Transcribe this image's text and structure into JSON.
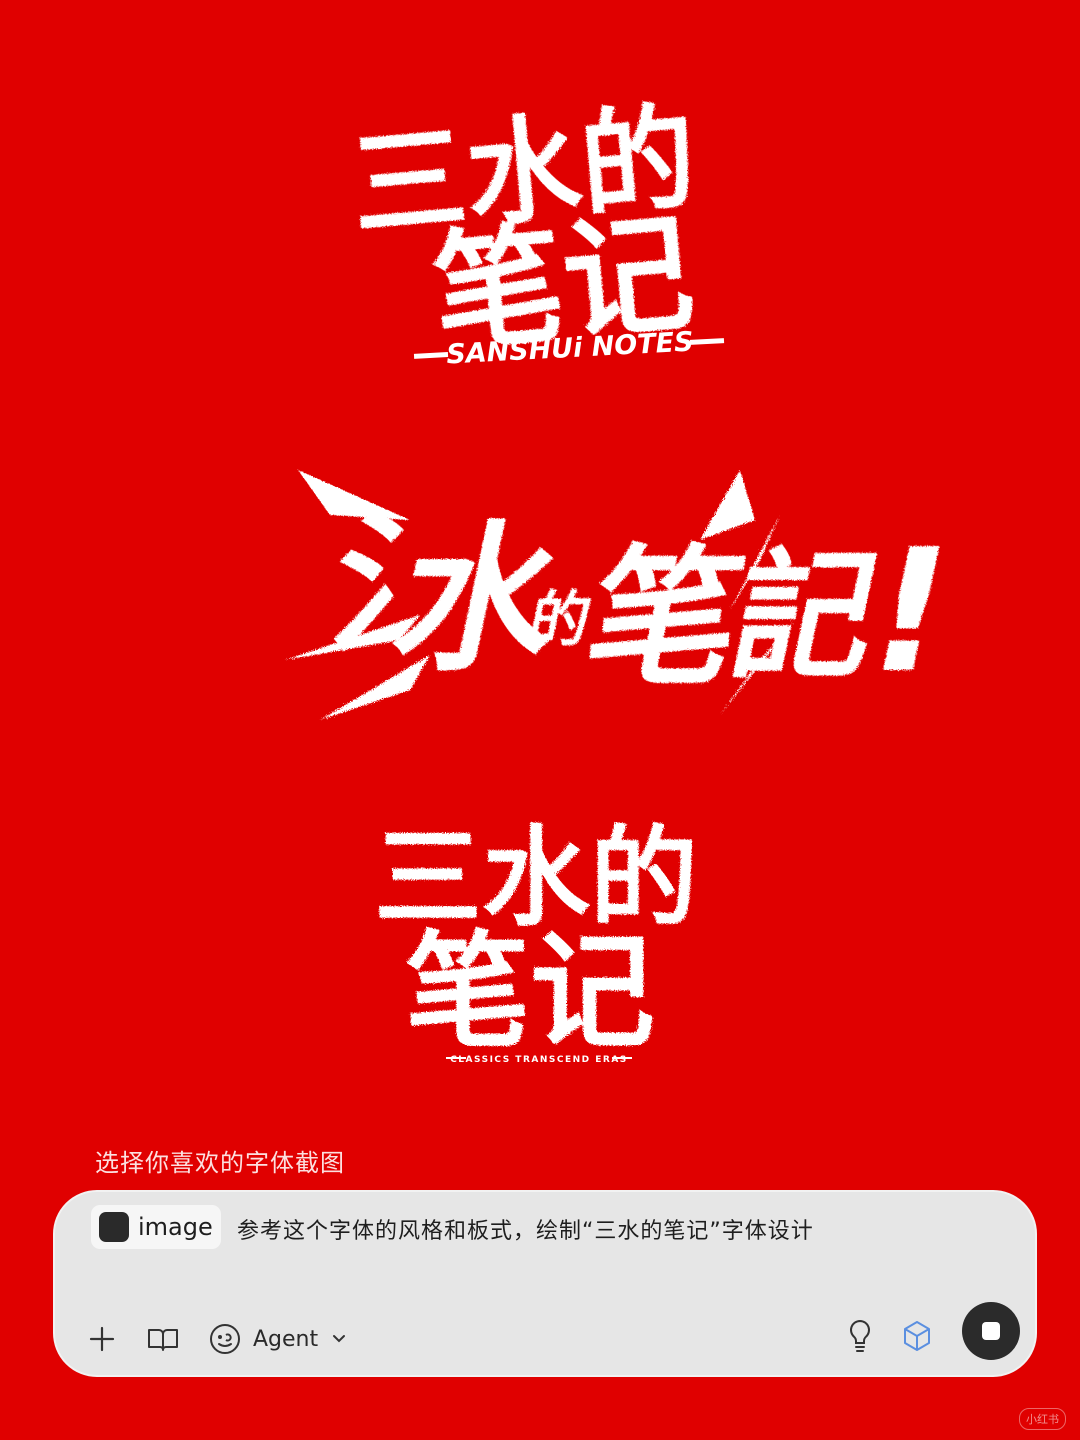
{
  "logos": {
    "logo1": {
      "line1": "三水的",
      "line2": "笔记",
      "tagline": "SANSHUi NOTES"
    },
    "logo2": {
      "c1": "氵",
      "c2": "水",
      "c3": "的",
      "c4": "笔",
      "c5": "記",
      "c6": "!"
    },
    "logo3": {
      "line1": "三水的",
      "line2": "笔记",
      "tagline": "CLASSICS TRANSCEND ERAS"
    }
  },
  "caption": "选择你喜欢的字体截图",
  "composer": {
    "attachment_label": "image",
    "prompt": "参考这个字体的风格和板式，绘制“三水的笔记”字体设计",
    "agent_label": "Agent"
  },
  "icons": {
    "plus": "plus-icon",
    "book": "book-icon",
    "agent": "agent-face-icon",
    "chevron": "chevron-down-icon",
    "bulb": "lightbulb-icon",
    "cube": "cube-icon",
    "stop": "stop-icon"
  },
  "colors": {
    "background": "#E00000",
    "panel": "#E6E6E6",
    "accent_cube": "#5B8FE0",
    "stop_button": "#2B2B2B"
  },
  "watermark": "小红书"
}
